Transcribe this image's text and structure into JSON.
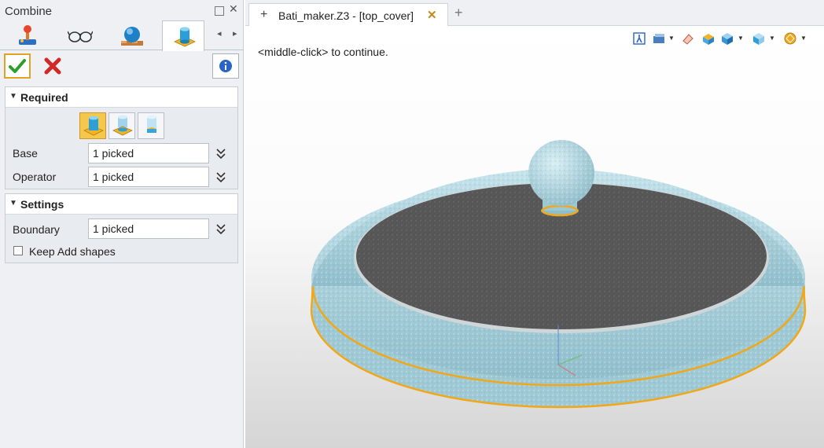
{
  "panel": {
    "title": "Combine",
    "tabs": [
      {
        "icon": "joystick-icon"
      },
      {
        "icon": "glasses-icon"
      },
      {
        "icon": "sphere-render-icon"
      },
      {
        "icon": "combine-shapes-icon"
      }
    ],
    "actions": {
      "ok_icon": "checkmark-icon",
      "cancel_icon": "x-icon",
      "info_icon": "info-icon"
    },
    "required": {
      "title": "Required",
      "modes": [
        "add-mode-icon",
        "subtract-mode-icon",
        "intersect-mode-icon"
      ],
      "base_label": "Base",
      "base_value": "1 picked",
      "operator_label": "Operator",
      "operator_value": "1 picked"
    },
    "settings": {
      "title": "Settings",
      "boundary_label": "Boundary",
      "boundary_value": "1 picked",
      "keep_add_label": "Keep Add shapes",
      "keep_add_checked": false
    }
  },
  "document": {
    "tab_label": "Bati_maker.Z3 - [top_cover]",
    "prompt": "<middle-click> to continue.",
    "toolbar_icons": [
      "exit-sketch-icon",
      "view-filter-icon",
      "eraser-icon",
      "box-icon",
      "cube-view-icon",
      "display-mode-icon",
      "render-style-icon"
    ]
  },
  "colors": {
    "accent": "#e1a425",
    "highlight": "#f5c84b",
    "model_surface": "#a9d3dd",
    "model_top": "#5b5b5b",
    "edge_highlight": "#f0a818"
  }
}
